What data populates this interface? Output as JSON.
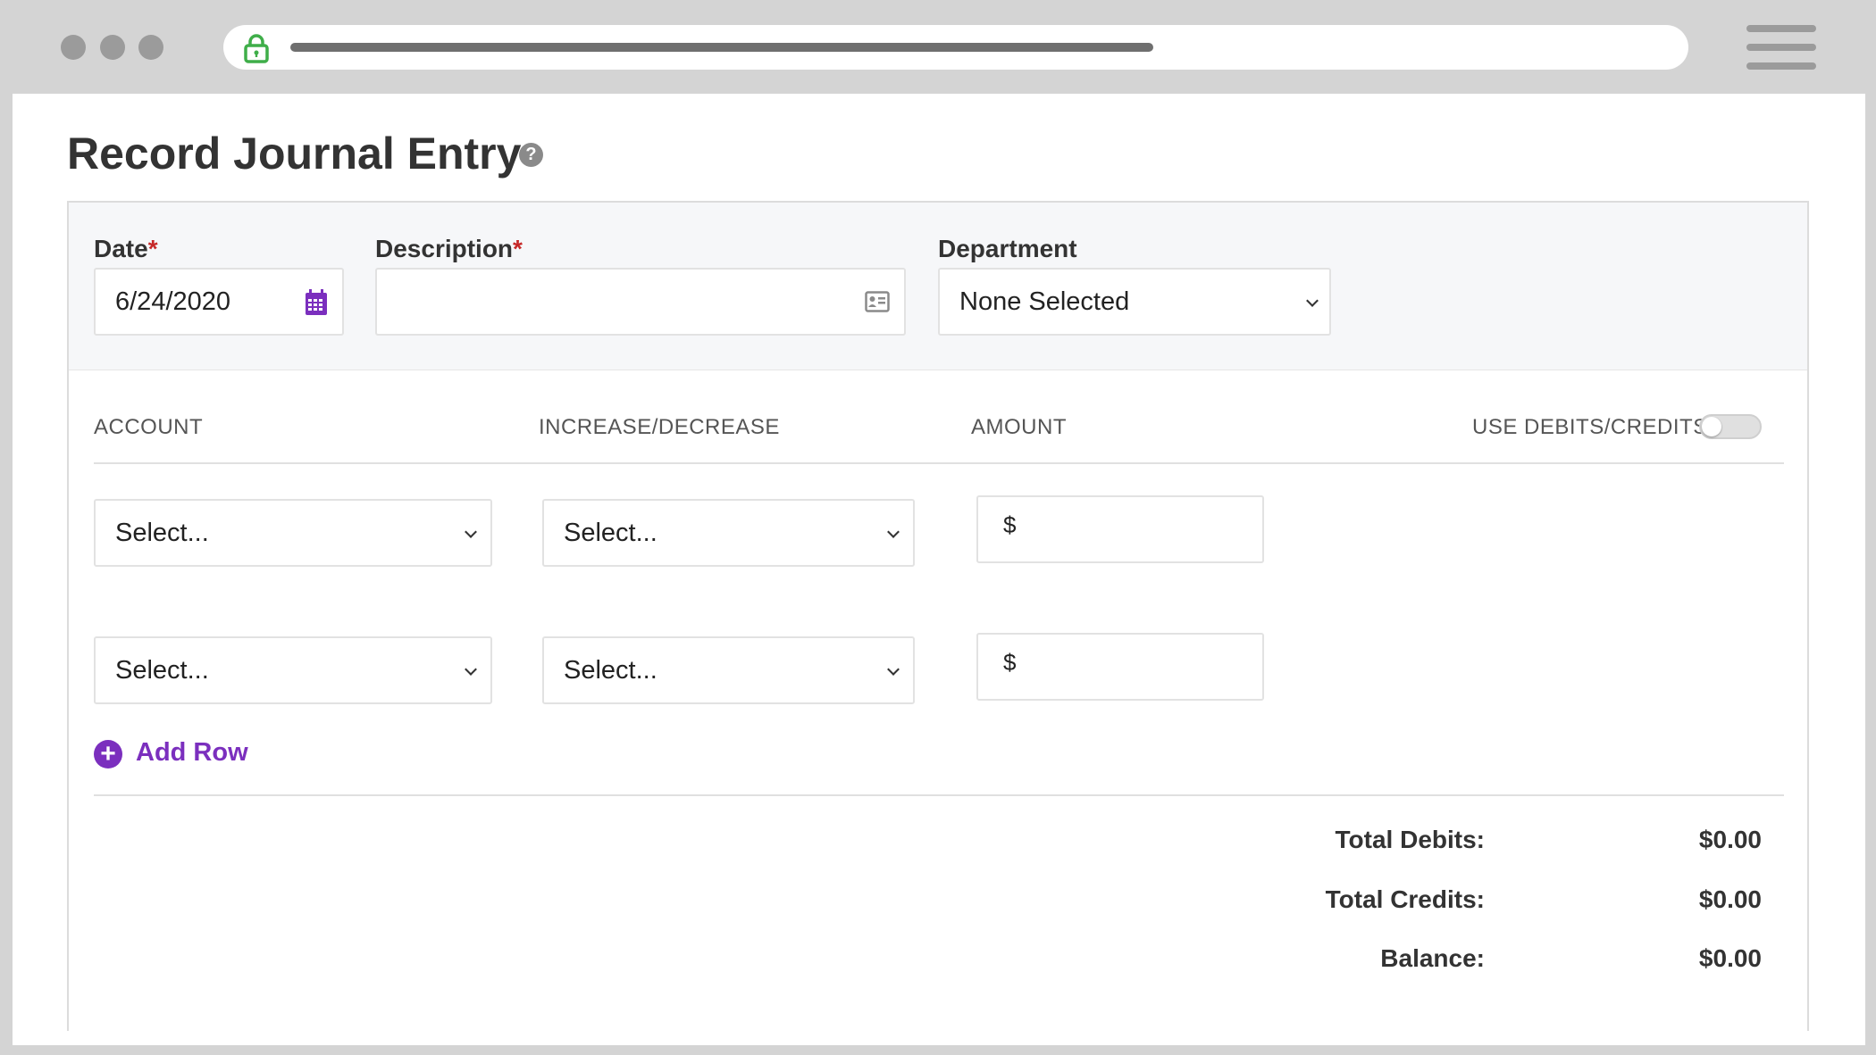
{
  "browser": {
    "lock_color": "#3fae49"
  },
  "page": {
    "title": "Record Journal Entry",
    "help_icon": "?"
  },
  "form": {
    "date": {
      "label": "Date",
      "required_mark": "*",
      "value": "6/24/2020",
      "icon": "calendar-icon"
    },
    "description": {
      "label": "Description",
      "required_mark": "*",
      "value": "",
      "icon": "contact-card-icon"
    },
    "department": {
      "label": "Department",
      "selected": "None Selected"
    }
  },
  "lines": {
    "headers": {
      "account": "ACCOUNT",
      "increase_decrease": "INCREASE/DECREASE",
      "amount": "AMOUNT",
      "use_debits_credits": "USE DEBITS/CREDITS"
    },
    "toggle_on": false,
    "rows": [
      {
        "account": "Select...",
        "increase_decrease": "Select...",
        "currency": "$",
        "amount": ""
      },
      {
        "account": "Select...",
        "increase_decrease": "Select...",
        "currency": "$",
        "amount": ""
      }
    ],
    "add_row_label": "Add Row"
  },
  "totals": {
    "debits_label": "Total Debits:",
    "debits_value": "$0.00",
    "credits_label": "Total Credits:",
    "credits_value": "$0.00",
    "balance_label": "Balance:",
    "balance_value": "$0.00"
  },
  "colors": {
    "accent": "#7b2fbe",
    "required": "#c62828"
  }
}
